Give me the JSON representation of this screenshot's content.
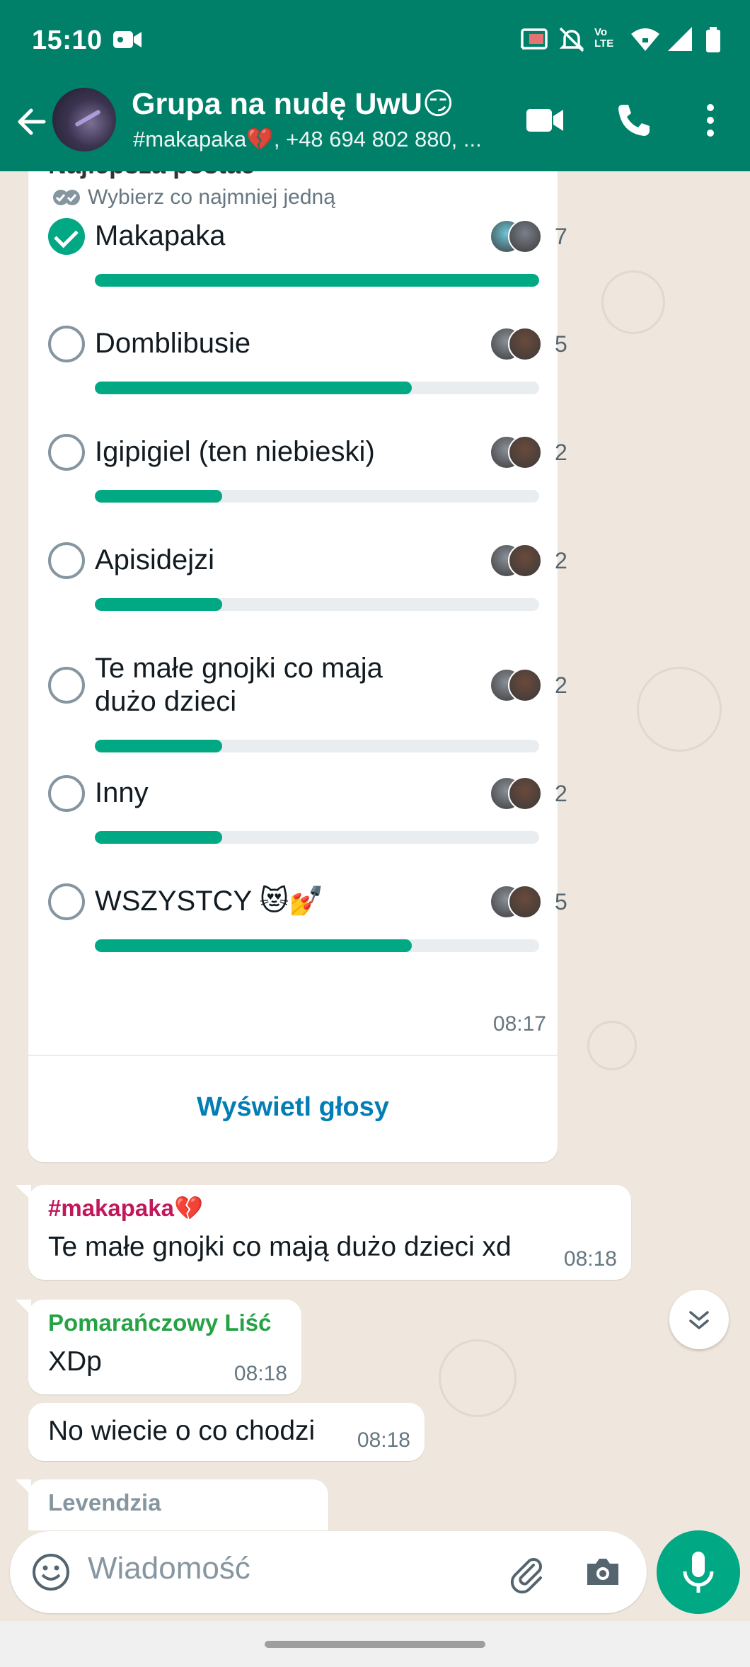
{
  "status_bar": {
    "time": "15:10",
    "icons": [
      "video-recording-icon",
      "cast-icon",
      "bell-off-icon",
      "volte-icon",
      "wifi-icon",
      "signal-icon",
      "battery-icon"
    ],
    "volte_label": "Vo LTE"
  },
  "chat_header": {
    "title": "Grupa na nudę UwU😏",
    "subtitle": "#makapaka💔, +48 694 802 880, ...",
    "accent_color": "#008069"
  },
  "poll": {
    "question": "Najlepsza postać",
    "hint": "Wybierz co najmniej jedną",
    "options": [
      {
        "label": "Makapaka",
        "votes": "7",
        "fraction": 1.0,
        "checked": true
      },
      {
        "label": "Domblibusie",
        "votes": "5",
        "fraction": 0.714,
        "checked": false
      },
      {
        "label": "Igipigiel (ten niebieski)",
        "votes": "2",
        "fraction": 0.286,
        "checked": false
      },
      {
        "label": "Apisidejzi",
        "votes": "2",
        "fraction": 0.286,
        "checked": false
      },
      {
        "label": "Te małe gnojki co maja dużo dzieci",
        "votes": "2",
        "fraction": 0.286,
        "checked": false
      },
      {
        "label": "Inny",
        "votes": "2",
        "fraction": 0.286,
        "checked": false
      },
      {
        "label": "WSZYSTCY 😻💅",
        "votes": "5",
        "fraction": 0.714,
        "checked": false
      }
    ],
    "time": "08:17",
    "view_votes_label": "Wyświetl głosy",
    "bar_color": "#00a884"
  },
  "messages": [
    {
      "sender": "#makapaka💔",
      "sender_color": "#c2185b",
      "text": "Te małe gnojki co mają dużo dzieci xd",
      "time": "08:18"
    },
    {
      "sender": "Pomarańczowy Liść",
      "sender_color": "#25a244",
      "text": "XDp",
      "time": "08:18"
    },
    {
      "sender": "",
      "text": "No wiecie o co chodzi",
      "time": "08:18"
    },
    {
      "sender": "Levendzia",
      "sender_color": "#8696a0",
      "text": "",
      "time": ""
    }
  ],
  "composer": {
    "placeholder": "Wiadomość"
  }
}
